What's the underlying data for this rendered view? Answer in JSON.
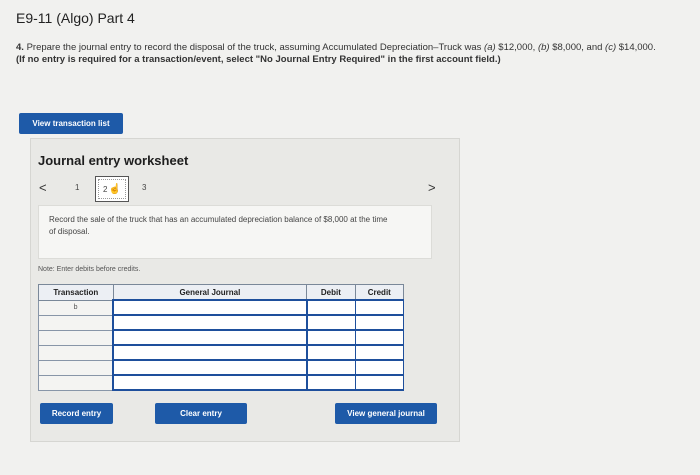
{
  "page": {
    "title": "E9-11 (Algo) Part 4"
  },
  "question": {
    "number": "4.",
    "text_a": "Prepare the journal entry to record the disposal of the truck, assuming Accumulated Depreciation–Truck was ",
    "label_a": "(a)",
    "value_a": " $12,000, ",
    "label_b": "(b)",
    "value_b": " $8,000, and ",
    "label_c": "(c)",
    "value_c": " $14,000. ",
    "instruction": "(If no entry is required for a transaction/event, select \"No Journal Entry Required\" in the first account field.)"
  },
  "buttons": {
    "view_transaction_list": "View transaction list",
    "record_entry": "Record entry",
    "clear_entry": "Clear entry",
    "view_general_journal": "View general journal"
  },
  "worksheet": {
    "title": "Journal entry worksheet",
    "pager": {
      "prev": "<",
      "next": ">",
      "pages": [
        "1",
        "2",
        "3"
      ],
      "current": "2"
    },
    "description": "Record the sale of the truck that has an accumulated depreciation balance of $8,000 at the time of disposal.",
    "note": "Note: Enter debits before credits.",
    "table": {
      "headers": [
        "Transaction",
        "General Journal",
        "Debit",
        "Credit"
      ],
      "rows": [
        {
          "transaction": "b",
          "account": "",
          "debit": "",
          "credit": ""
        },
        {
          "transaction": "",
          "account": "",
          "debit": "",
          "credit": ""
        },
        {
          "transaction": "",
          "account": "",
          "debit": "",
          "credit": ""
        },
        {
          "transaction": "",
          "account": "",
          "debit": "",
          "credit": ""
        },
        {
          "transaction": "",
          "account": "",
          "debit": "",
          "credit": ""
        },
        {
          "transaction": "",
          "account": "",
          "debit": "",
          "credit": ""
        }
      ]
    }
  },
  "colors": {
    "accent": "#1e5aa8",
    "table_border": "#1e4f9c",
    "background": "#f1f1ef"
  }
}
